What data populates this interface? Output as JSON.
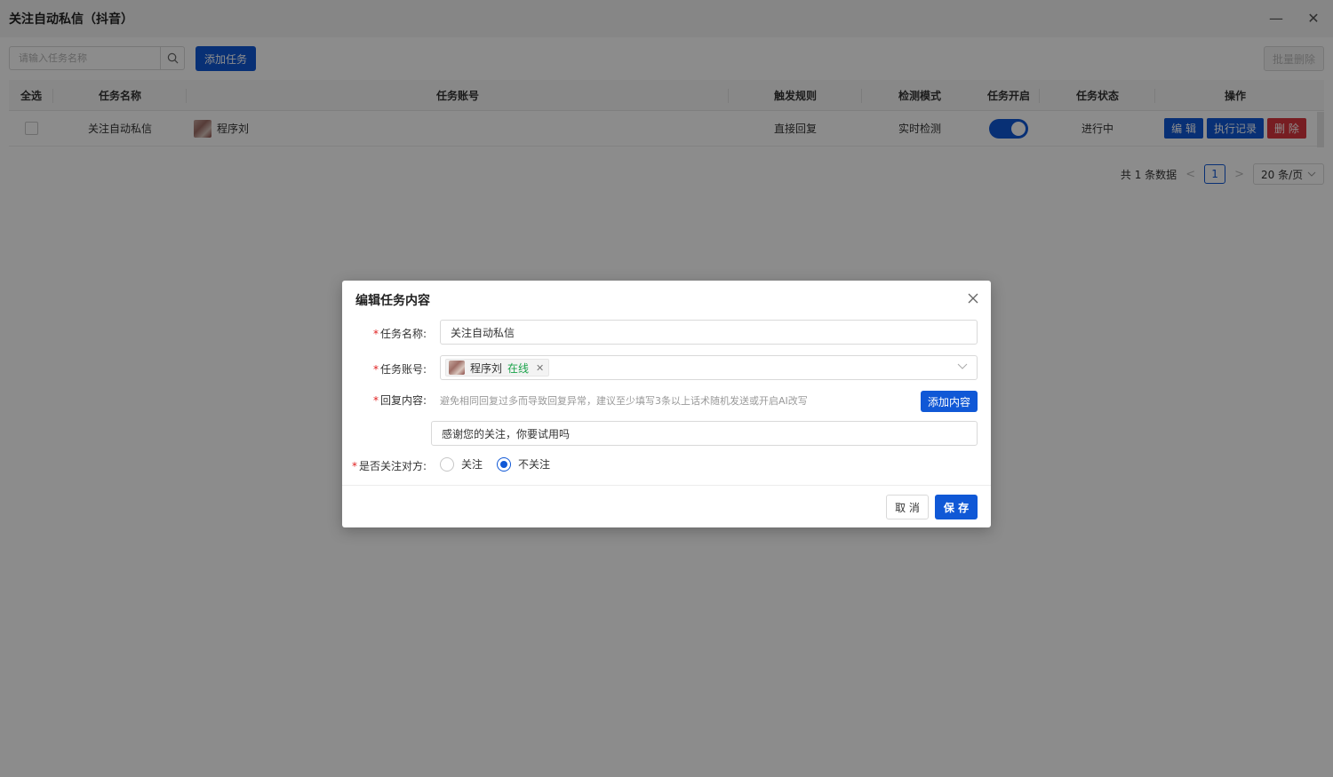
{
  "window": {
    "title": "关注自动私信（抖音）",
    "minimize_glyph": "—",
    "close_glyph": "✕"
  },
  "toolbar": {
    "search_placeholder": "请输入任务名称",
    "add_task_label": "添加任务",
    "batch_delete_label": "批量删除"
  },
  "table": {
    "headers": [
      "全选",
      "任务名称",
      "任务账号",
      "触发规则",
      "检测模式",
      "任务开启",
      "任务状态",
      "操作"
    ],
    "rows": [
      {
        "task_name": "关注自动私信",
        "account": "程序刘",
        "trigger_rule": "直接回复",
        "detect_mode": "实时检测",
        "enabled": true,
        "status": "进行中",
        "ops": {
          "edit": "编 辑",
          "log": "执行记录",
          "delete": "删 除"
        }
      }
    ]
  },
  "pagination": {
    "total_text": "共 1 条数据",
    "prev": "<",
    "current_page": "1",
    "next": ">",
    "page_size": "20 条/页"
  },
  "modal": {
    "title": "编辑任务内容",
    "fields": {
      "task_name_label": "任务名称:",
      "task_name_value": "关注自动私信",
      "account_label": "任务账号:",
      "account_tag_name": "程序刘",
      "account_tag_status": "在线",
      "reply_label": "回复内容:",
      "reply_hint": "避免相同回复过多而导致回复异常，建议至少填写3条以上话术随机发送或开启AI改写",
      "add_content_label": "添加内容",
      "reply_value": "感谢您的关注，你要试用吗",
      "follow_label": "是否关注对方:",
      "follow_options": [
        "关注",
        "不关注"
      ],
      "follow_selected": "不关注"
    },
    "footer": {
      "cancel_label": "取 消",
      "save_label": "保 存"
    }
  },
  "colors": {
    "primary": "#1058d6",
    "danger": "#d9363e",
    "online": "#1aa34a",
    "required": "#e02020"
  }
}
